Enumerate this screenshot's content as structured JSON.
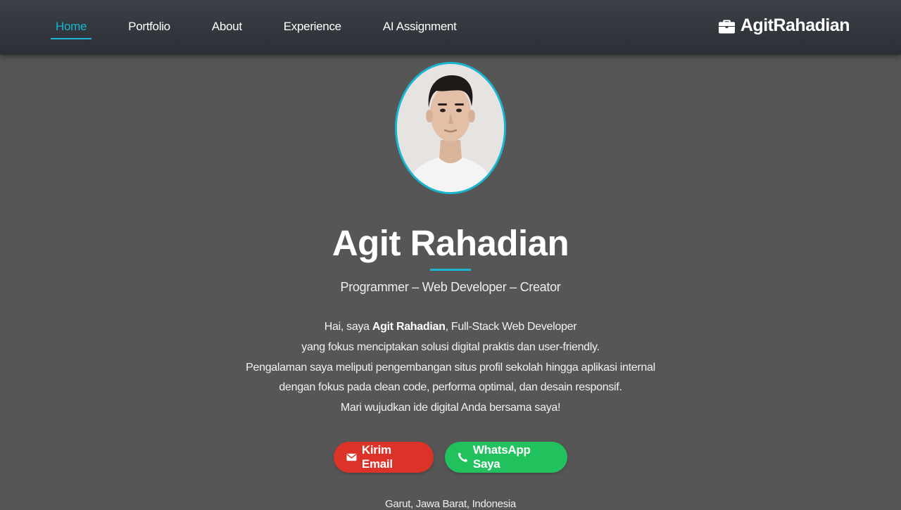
{
  "nav": {
    "links": [
      {
        "label": "Home",
        "active": true
      },
      {
        "label": "Portfolio",
        "active": false
      },
      {
        "label": "About",
        "active": false
      },
      {
        "label": "Experience",
        "active": false
      },
      {
        "label": "AI Assignment",
        "active": false
      }
    ],
    "brand": {
      "label": "AgitRahadian",
      "icon": "briefcase-icon"
    }
  },
  "hero": {
    "avatar_icon": "profile-photo",
    "name": "Agit Rahadian",
    "tagline": "Programmer – Web Developer – Creator",
    "bio": {
      "intro_prefix": "Hai, saya ",
      "intro_name": "Agit Rahadian",
      "intro_suffix": ", Full-Stack Web Developer",
      "line2": "yang fokus menciptakan solusi digital praktis dan user-friendly.",
      "line3": "Pengalaman saya meliputi pengembangan situs profil sekolah hingga aplikasi internal",
      "line4": "dengan fokus pada clean code, performa optimal, dan desain responsif.",
      "line5": "Mari wujudkan ide digital Anda bersama saya!"
    },
    "buttons": {
      "email": {
        "label": "Kirim Email",
        "icon": "envelope-icon",
        "color": "#dc3328"
      },
      "whatsapp": {
        "label": "WhatsApp Saya",
        "icon": "phone-icon",
        "color": "#21c15e"
      }
    },
    "location": "Garut, Jawa Barat, Indonesia"
  },
  "colors": {
    "accent": "#1ab6d1",
    "background": "#565656",
    "navbar": "#2f333a"
  }
}
